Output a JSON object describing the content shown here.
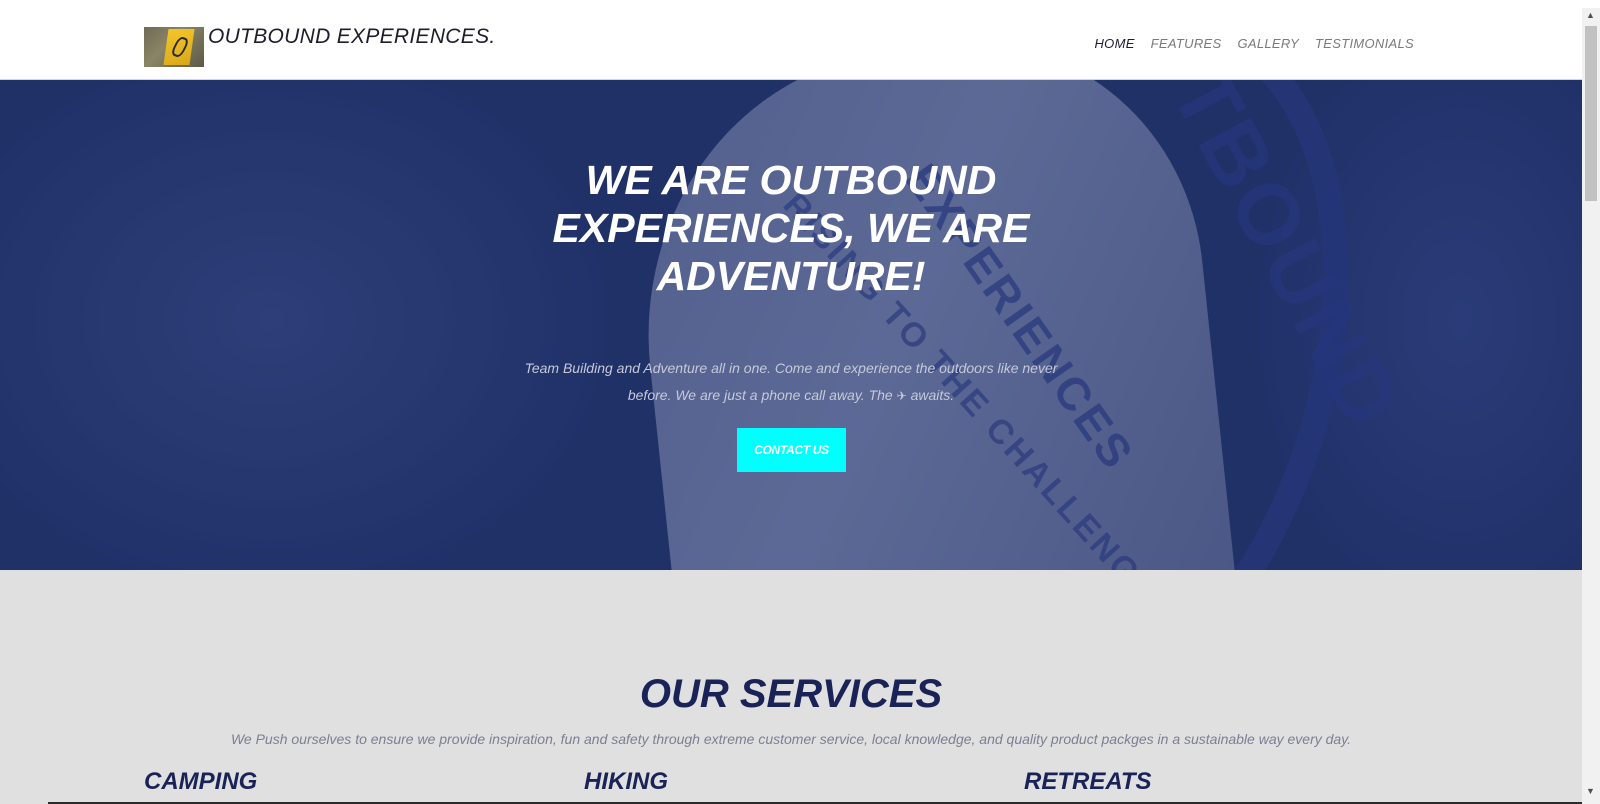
{
  "brand": {
    "name": "OUTBOUND EXPERIENCES."
  },
  "nav": {
    "items": [
      {
        "label": "HOME",
        "active": true
      },
      {
        "label": "FEATURES",
        "active": false
      },
      {
        "label": "GALLERY",
        "active": false
      },
      {
        "label": "TESTIMONIALS",
        "active": false
      }
    ]
  },
  "hero": {
    "title": "WE ARE OUTBOUND EXPERIENCES, WE ARE ADVENTURE!",
    "subtitle_before": "Team Building and Adventure all in one. Come and experience the outdoors like never before. We are just a phone call away. The",
    "subtitle_icon": "airplane-icon",
    "subtitle_after": "awaits.",
    "cta_label": "CONTACT US"
  },
  "services": {
    "title": "OUR SERVICES",
    "description": "We Push ourselves to ensure we provide inspiration, fun and safety through extreme customer service, local knowledge, and quality product packges in a sustainable way every day.",
    "items": [
      {
        "title": "CAMPING"
      },
      {
        "title": "HIKING"
      },
      {
        "title": "RETREATS"
      }
    ]
  },
  "colors": {
    "hero_overlay": "#23336b",
    "cta": "#00ffff",
    "heading": "#1a2357",
    "section_bg": "#e0e0e0"
  }
}
